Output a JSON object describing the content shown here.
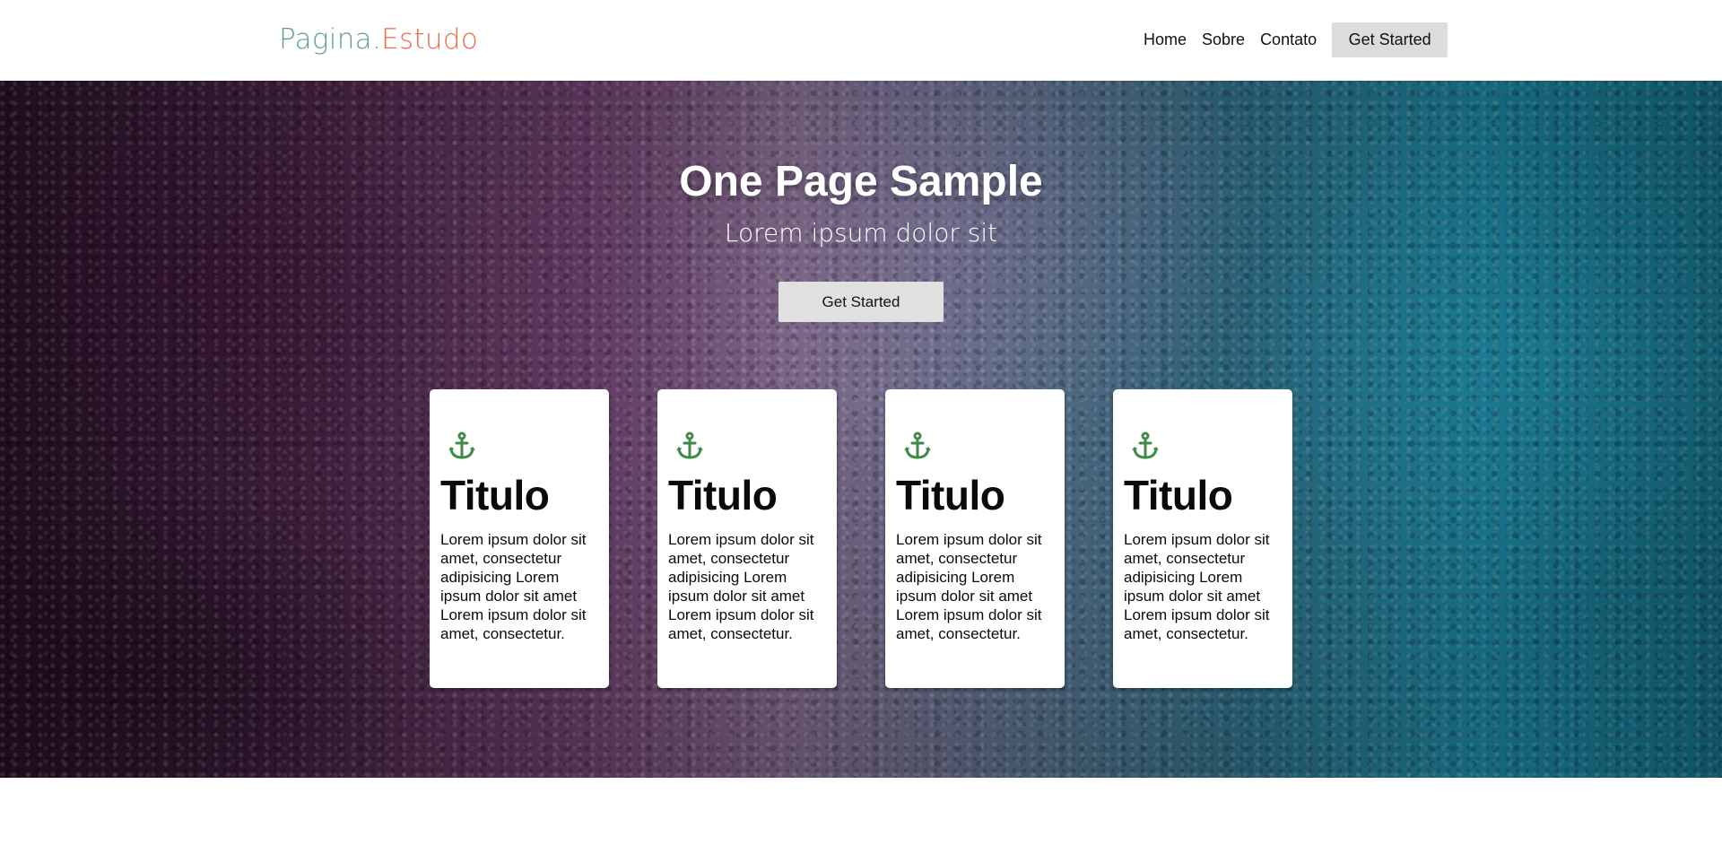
{
  "header": {
    "logo_part1": "Pagina.",
    "logo_part2": "Estudo",
    "nav": {
      "home": "Home",
      "sobre": "Sobre",
      "contato": "Contato",
      "cta": "Get Started"
    }
  },
  "hero": {
    "title": "One Page Sample",
    "subtitle": "Lorem ipsum dolor sit",
    "cta": "Get Started"
  },
  "cards": [
    {
      "icon": "anchor-icon",
      "title": "Titulo",
      "text": "Lorem ipsum dolor sit amet, consectetur adipisicing Lorem ipsum dolor sit amet Lorem ipsum dolor sit amet, consectetur."
    },
    {
      "icon": "anchor-icon",
      "title": "Titulo",
      "text": "Lorem ipsum dolor sit amet, consectetur adipisicing Lorem ipsum dolor sit amet Lorem ipsum dolor sit amet, consectetur."
    },
    {
      "icon": "anchor-icon",
      "title": "Titulo",
      "text": "Lorem ipsum dolor sit amet, consectetur adipisicing Lorem ipsum dolor sit amet Lorem ipsum dolor sit amet, consectetur."
    },
    {
      "icon": "anchor-icon",
      "title": "Titulo",
      "text": "Lorem ipsum dolor sit amet, consectetur adipisicing Lorem ipsum dolor sit amet Lorem ipsum dolor sit amet, consectetur."
    }
  ],
  "colors": {
    "logo_part1": "#5aa37c",
    "logo_part2": "#ef6a4b",
    "anchor_icon": "#3f8a4a",
    "button_bg": "#dcdcdc"
  }
}
